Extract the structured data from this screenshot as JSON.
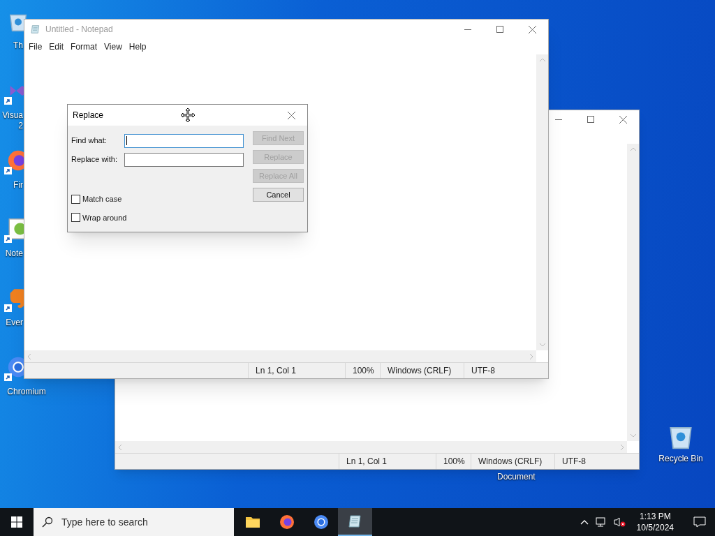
{
  "desktop_icons": [
    {
      "kind": "recycle",
      "lines": [
        "Th"
      ]
    },
    {
      "kind": "studio",
      "lines": [
        "Visua",
        "2"
      ]
    },
    {
      "kind": "firefox",
      "lines": [
        "Fir"
      ]
    },
    {
      "kind": "notepadpp",
      "lines": [
        "Note"
      ]
    },
    {
      "kind": "evernote",
      "lines": [
        "Ever"
      ]
    },
    {
      "kind": "chromium",
      "lines": [
        "Chromium"
      ]
    }
  ],
  "document_icon": {
    "label": "Document"
  },
  "recycle_bin": {
    "label": "Recycle Bin"
  },
  "back_window": {
    "status_bar": [
      "Ln 1, Col 1",
      "100%",
      "Windows (CRLF)",
      "UTF-8"
    ]
  },
  "notepad": {
    "title": "Untitled - Notepad",
    "menu": [
      "File",
      "Edit",
      "Format",
      "View",
      "Help"
    ],
    "status_bar": [
      "Ln 1, Col 1",
      "100%",
      "Windows (CRLF)",
      "UTF-8"
    ]
  },
  "dialog": {
    "title": "Replace",
    "fields": [
      {
        "label": "Find what:",
        "focused": true
      },
      {
        "label": "Replace with:",
        "focused": false
      }
    ],
    "buttons": [
      {
        "label": "Find Next",
        "disabled": true
      },
      {
        "label": "Replace",
        "disabled": true
      },
      {
        "label": "Replace All",
        "disabled": true
      },
      {
        "label": "Cancel",
        "disabled": false
      }
    ],
    "checkboxes": [
      {
        "label": "Match case",
        "checked": false
      },
      {
        "label": "Wrap around",
        "checked": false
      }
    ]
  },
  "taskbar": {
    "search": {
      "placeholder": "Type here to search"
    },
    "apps": [
      {
        "kind": "folder",
        "selected": false
      },
      {
        "kind": "firefox",
        "selected": false
      },
      {
        "kind": "chromium",
        "selected": false
      },
      {
        "kind": "notepad",
        "selected": true
      }
    ],
    "time": "1:13 PM",
    "date": "10/5/2024"
  }
}
